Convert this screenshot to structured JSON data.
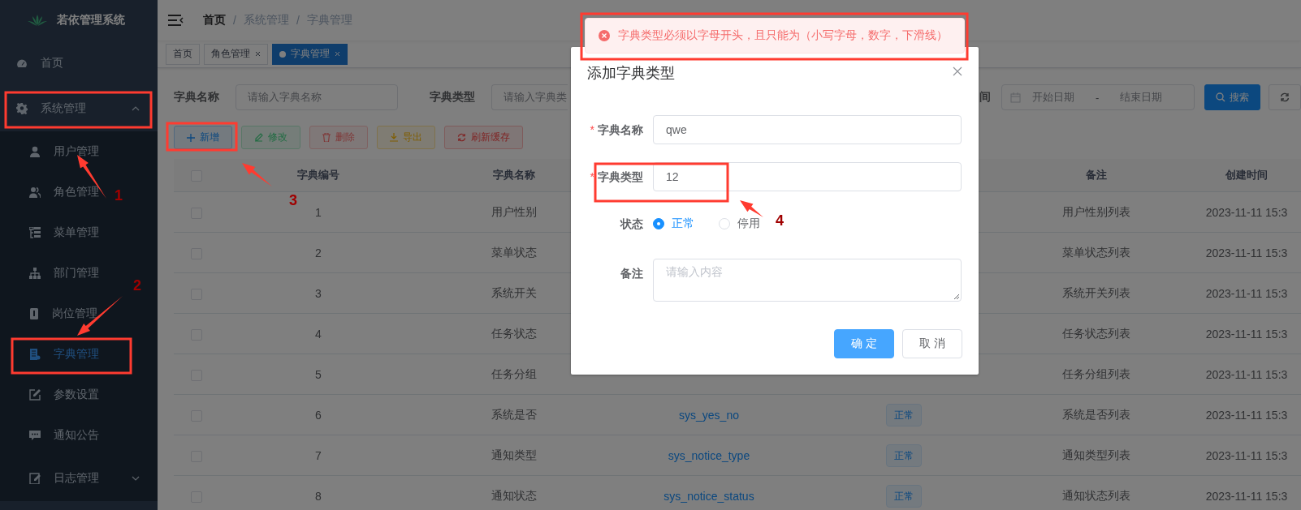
{
  "sidebar": {
    "title": "若依管理系统",
    "items": [
      {
        "label": "首页",
        "selected": false
      },
      {
        "label": "系统管理",
        "selected": false,
        "expanded": true,
        "children": [
          {
            "label": "用户管理",
            "selected": false
          },
          {
            "label": "角色管理",
            "selected": false
          },
          {
            "label": "菜单管理",
            "selected": false
          },
          {
            "label": "部门管理",
            "selected": false
          },
          {
            "label": "岗位管理",
            "selected": false
          },
          {
            "label": "字典管理",
            "selected": true
          },
          {
            "label": "参数设置",
            "selected": false
          },
          {
            "label": "通知公告",
            "selected": false
          },
          {
            "label": "日志管理",
            "selected": false,
            "expanded": false
          }
        ]
      }
    ]
  },
  "breadcrumb": {
    "items": [
      "首页",
      "系统管理",
      "字典管理"
    ],
    "separators": [
      "/",
      "/"
    ]
  },
  "tabs": [
    {
      "label": "首页",
      "selected": false,
      "closable": false
    },
    {
      "label": "角色管理",
      "selected": false,
      "closable": true
    },
    {
      "label": "字典管理",
      "selected": true,
      "closable": true
    }
  ],
  "search": {
    "fields": [
      {
        "label": "字典名称",
        "placeholder": "请输入字典名称"
      },
      {
        "label": "字典类型",
        "placeholder": "请输入字典类"
      }
    ],
    "date": {
      "label": "间",
      "start_placeholder": "开始日期",
      "separator": "-",
      "end_placeholder": "结束日期"
    },
    "search_button": "搜索"
  },
  "toolbar": [
    {
      "label": "新增",
      "kind": "primary",
      "disabled": false
    },
    {
      "label": "修改",
      "kind": "success",
      "disabled": true
    },
    {
      "label": "删除",
      "kind": "danger",
      "disabled": true
    },
    {
      "label": "导出",
      "kind": "warning",
      "disabled": false
    },
    {
      "label": "刷新缓存",
      "kind": "danger",
      "disabled": false
    }
  ],
  "table": {
    "select_all_checked": false,
    "columns": {
      "number": "字典编号",
      "name": "字典名称",
      "remark": "备注",
      "created": "创建时间"
    },
    "rows": [
      {
        "checked": false,
        "number": "1",
        "name": "用户性别",
        "remark": "用户性别列表",
        "created": "2023-11-11 15:3"
      },
      {
        "checked": false,
        "number": "2",
        "name": "菜单状态",
        "remark": "菜单状态列表",
        "created": "2023-11-11 15:3"
      },
      {
        "checked": false,
        "number": "3",
        "name": "系统开关",
        "remark": "系统开关列表",
        "created": "2023-11-11 15:3"
      },
      {
        "checked": false,
        "number": "4",
        "name": "任务状态",
        "remark": "任务状态列表",
        "created": "2023-11-11 15:3"
      },
      {
        "checked": false,
        "number": "5",
        "name": "任务分组",
        "remark": "任务分组列表",
        "created": "2023-11-11 15:3"
      },
      {
        "checked": false,
        "number": "6",
        "name": "系统是否",
        "type": "sys_yes_no",
        "status": "正常",
        "remark": "系统是否列表",
        "created": "2023-11-11 15:3"
      },
      {
        "checked": false,
        "number": "7",
        "name": "通知类型",
        "type": "sys_notice_type",
        "status": "正常",
        "remark": "通知类型列表",
        "created": "2023-11-11 15:3"
      },
      {
        "checked": false,
        "number": "8",
        "name": "通知状态",
        "type": "sys_notice_status",
        "status": "正常",
        "remark": "通知状态列表",
        "created": "2023-11-11 15:3"
      }
    ]
  },
  "dialog": {
    "title": "添加字典类型",
    "fields": [
      {
        "kind": "text",
        "label": "字典名称",
        "required_mark": "*",
        "value": "qwe"
      },
      {
        "kind": "text",
        "label": "字典类型",
        "required_mark": "*",
        "value": "12"
      },
      {
        "kind": "radio",
        "label": "状态",
        "options": [
          {
            "label": "正常",
            "selected": true
          },
          {
            "label": "停用",
            "selected": false
          }
        ]
      },
      {
        "kind": "textarea",
        "label": "备注",
        "placeholder": "请输入内容"
      }
    ],
    "buttons": [
      {
        "label": "确 定",
        "kind": "primary"
      },
      {
        "label": "取 消",
        "kind": "default"
      }
    ]
  },
  "message": {
    "text": "字典类型必须以字母开头，且只能为（小写字母，数字，下滑线）"
  },
  "annotations": [
    {
      "label": "1"
    },
    {
      "label": "2"
    },
    {
      "label": "3"
    },
    {
      "label": "4"
    }
  ]
}
